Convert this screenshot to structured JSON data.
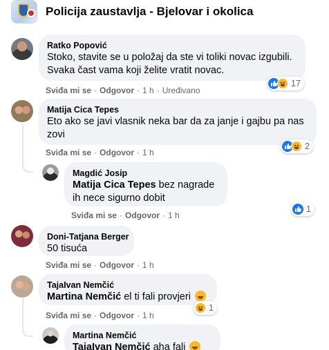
{
  "header": {
    "title": "Policija zaustavlja - Bjelovar i okolica"
  },
  "colors": {
    "bubble": "#f0f2f5",
    "like": "#1877f2",
    "haha": "#f7b928",
    "meta": "#65676b"
  },
  "actions": {
    "like": "Sviđa mi se",
    "reply": "Odgovor"
  },
  "comments": [
    {
      "author": "Ratko Popović",
      "text": "Stoko, stavite se u položaj da ste vi toliki novac izgubili. Svaka čast vama koji želite vratit novac.",
      "time": "1 h",
      "edited": "Uređivano",
      "reactions": [
        "like-icon",
        "haha-icon"
      ],
      "count": "17"
    },
    {
      "author": "Matija Cica Tepes",
      "text": "Eto ako se javi vlasnik neka bar da za janje i gajbu pa nas zovi",
      "time": "1 h",
      "reactions": [
        "like-icon",
        "haha-icon"
      ],
      "count": "2"
    },
    {
      "author": "Magdić Josip",
      "mention": "Matija Cica Tepes",
      "text": " bez nagrade ih nece sigurno dobit",
      "time": "1 h",
      "reactions": [
        "like-icon"
      ],
      "count": "1"
    },
    {
      "author": "Doni-Tatjana Berger",
      "text": "50 tisuća",
      "time": "1 h"
    },
    {
      "author": "TajaIvan Nemčić",
      "mention": "Martina Nemčić",
      "text": " el ti fali provjeri",
      "time": "1 h",
      "reactions": [
        "haha-icon"
      ],
      "count": "1"
    },
    {
      "author": "Martina Nemčić",
      "mention": "TajaIvan Nemčić",
      "text": " aha fali"
    }
  ]
}
